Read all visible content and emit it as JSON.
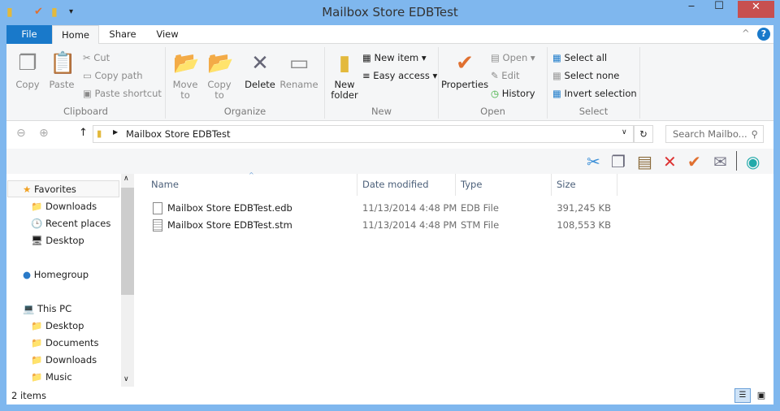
{
  "window": {
    "title": "Mailbox Store EDBTest",
    "minimize": "‒",
    "maximize": "☐",
    "close": "✕"
  },
  "ribbon_tabs": [
    "File",
    "Home",
    "Share",
    "View"
  ],
  "clipboard": {
    "label": "Clipboard",
    "copy": "Copy",
    "paste": "Paste",
    "cut": "Cut",
    "copy_path": "Copy path",
    "paste_shortcut": "Paste shortcut"
  },
  "organize": {
    "label": "Organize",
    "move_to": "Move to",
    "copy_to": "Copy to",
    "delete": "Delete",
    "rename": "Rename"
  },
  "new": {
    "label": "New",
    "new_folder": "New folder",
    "new_item": "New item ▾",
    "easy_access": "Easy access ▾"
  },
  "open": {
    "label": "Open",
    "properties": "Properties",
    "open": "Open ▾",
    "edit": "Edit",
    "history": "History"
  },
  "select": {
    "label": "Select",
    "select_all": "Select all",
    "select_none": "Select none",
    "invert": "Invert selection"
  },
  "address": {
    "path": "Mailbox Store EDBTest",
    "search_placeholder": "Search Mailbo..."
  },
  "nav": [
    {
      "label": "Favorites",
      "icon": "★",
      "level": 0
    },
    {
      "label": "Downloads",
      "icon": "📁",
      "level": 1
    },
    {
      "label": "Recent places",
      "icon": "🕒",
      "level": 1
    },
    {
      "label": "Desktop",
      "icon": "🖥",
      "level": 1
    },
    {
      "label": "Homegroup",
      "icon": "●",
      "level": 0
    },
    {
      "label": "This PC",
      "icon": "💻",
      "level": 0
    },
    {
      "label": "Desktop",
      "icon": "📁",
      "level": 1
    },
    {
      "label": "Documents",
      "icon": "📁",
      "level": 1
    },
    {
      "label": "Downloads",
      "icon": "📁",
      "level": 1
    },
    {
      "label": "Music",
      "icon": "📁",
      "level": 1
    }
  ],
  "columns": [
    "Name",
    "Date modified",
    "Type",
    "Size"
  ],
  "files": [
    {
      "name": "Mailbox Store EDBTest.edb",
      "date": "11/13/2014 4:48 PM",
      "type": "EDB File",
      "size": "391,245 KB"
    },
    {
      "name": "Mailbox Store EDBTest.stm",
      "date": "11/13/2014 4:48 PM",
      "type": "STM File",
      "size": "108,553 KB"
    }
  ],
  "status": {
    "items": "2 items"
  },
  "colors": {
    "title_bar": "#7fb7ee",
    "file_tab": "#1979ca",
    "close": "#c75050"
  }
}
